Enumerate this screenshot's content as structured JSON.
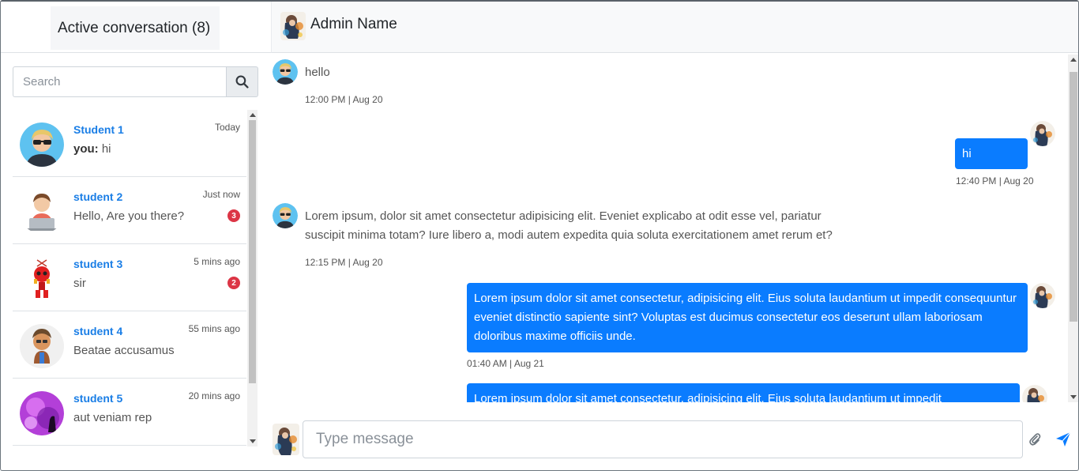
{
  "header": {
    "conversations_title": "Active conversation (8)",
    "admin_name": "Admin Name"
  },
  "search": {
    "placeholder": "Search",
    "value": ""
  },
  "conversations": [
    {
      "name": "Student 1",
      "time": "Today",
      "prefix": "you:",
      "message": " hi",
      "unread": "",
      "avatar": "sunglasses-user-avatar"
    },
    {
      "name": "student 2",
      "time": "Just now",
      "prefix": "",
      "message": "Hello, Are you there?",
      "unread": "3",
      "avatar": "laptop-user-avatar"
    },
    {
      "name": "student 3",
      "time": "5 mins ago",
      "prefix": "",
      "message": "sir",
      "unread": "2",
      "avatar": "robot-avatar"
    },
    {
      "name": "student 4",
      "time": "55 mins ago",
      "prefix": "",
      "message": "Beatae accusamus",
      "unread": "",
      "avatar": "cartoon-man-avatar"
    },
    {
      "name": "student 5",
      "time": "20 mins ago",
      "prefix": "",
      "message": "aut veniam rep",
      "unread": "",
      "avatar": "purple-art-avatar"
    }
  ],
  "messages": [
    {
      "side": "left",
      "text": "hello",
      "time": "12:00 PM | Aug 20"
    },
    {
      "side": "right",
      "text": "hi",
      "time": "12:40 PM | Aug 20"
    },
    {
      "side": "left",
      "text": "Lorem ipsum, dolor sit amet consectetur adipisicing elit. Eveniet explicabo at odit esse vel, pariatur suscipit minima totam? Iure libero a, modi autem expedita quia soluta exercitationem amet rerum et?",
      "time": "12:15 PM | Aug 20"
    },
    {
      "side": "right",
      "text": "Lorem ipsum dolor sit amet consectetur, adipisicing elit. Eius soluta laudantium ut impedit consequuntur eveniet distinctio sapiente sint? Voluptas est ducimus consectetur eos deserunt ullam laboriosam doloribus maxime officiis unde.",
      "time": "01:40 AM | Aug 21"
    },
    {
      "side": "right",
      "text": "Lorem ipsum dolor sit amet consectetur, adipisicing elit. Eius soluta laudantium ut impedit",
      "time": ""
    }
  ],
  "composer": {
    "placeholder": "Type message",
    "value": ""
  },
  "icons": {
    "search": "search-icon",
    "attach": "paperclip-icon",
    "send": "send-icon"
  },
  "colors": {
    "accent": "#0a7cff",
    "name_link": "#1a7ee6",
    "badge": "#dc3545"
  }
}
